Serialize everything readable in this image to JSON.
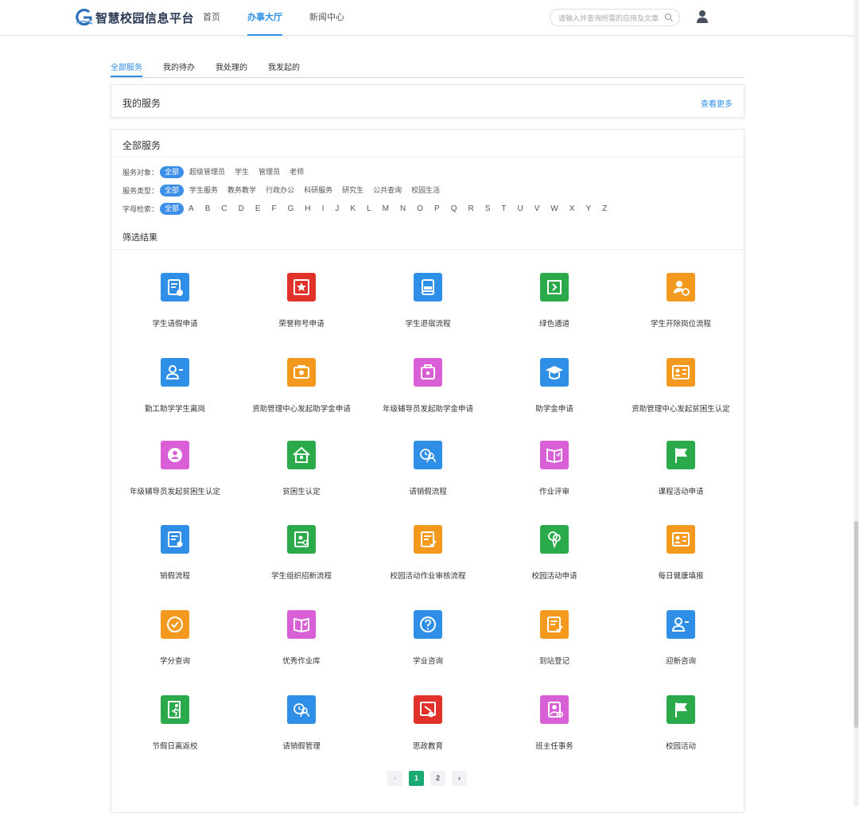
{
  "header": {
    "app_title": "智慧校园信息平台",
    "nav": [
      {
        "label": "首页",
        "active": false
      },
      {
        "label": "办事大厅",
        "active": true
      },
      {
        "label": "新闻中心",
        "active": false
      }
    ],
    "search_placeholder": "请输入并查询所需的应用及文章",
    "accent_color": "#2f8fe6"
  },
  "tabs": [
    {
      "label": "全部服务",
      "active": true
    },
    {
      "label": "我的待办",
      "active": false
    },
    {
      "label": "我处理的",
      "active": false
    },
    {
      "label": "我发起的",
      "active": false
    }
  ],
  "my_services": {
    "title": "我的服务",
    "more_label": "查看更多"
  },
  "all_services": {
    "title": "全部服务",
    "filters": {
      "target": {
        "label": "服务对象：",
        "options": [
          "全部",
          "超级管理员",
          "学生",
          "管理员",
          "老师"
        ],
        "selected": "全部"
      },
      "type": {
        "label": "服务类型：",
        "options": [
          "全部",
          "学生服务",
          "教务教学",
          "行政办公",
          "科研服务",
          "研究生",
          "公共查询",
          "校园生活"
        ],
        "selected": "全部"
      },
      "letter": {
        "label": "字母检索：",
        "options": [
          "全部",
          "A",
          "B",
          "C",
          "D",
          "E",
          "F",
          "G",
          "H",
          "I",
          "J",
          "K",
          "L",
          "M",
          "N",
          "O",
          "P",
          "Q",
          "R",
          "S",
          "T",
          "U",
          "V",
          "W",
          "X",
          "Y",
          "Z"
        ],
        "selected": "全部"
      }
    },
    "result_title": "筛选结果",
    "items": [
      {
        "label": "学生请假申请",
        "color": "#2f8fe6",
        "icon": "leave-form-icon"
      },
      {
        "label": "荣誉称号申请",
        "color": "#e0322b",
        "icon": "honor-icon"
      },
      {
        "label": "学生退宿流程",
        "color": "#2f8fe6",
        "icon": "bed-icon"
      },
      {
        "label": "绿色通道",
        "color": "#2aaa4a",
        "icon": "green-channel-icon"
      },
      {
        "label": "学生开除岗位流程",
        "color": "#f39a1e",
        "icon": "user-clock-icon"
      },
      {
        "label": "勤工助学学生离岗",
        "color": "#2f8fe6",
        "icon": "user-minus-icon"
      },
      {
        "label": "资助管理中心发起助学金申请",
        "color": "#f39a1e",
        "icon": "money-icon"
      },
      {
        "label": "年级辅导员发起助学金申请",
        "color": "#d95fd6",
        "icon": "bag-icon"
      },
      {
        "label": "助学金申请",
        "color": "#2f8fe6",
        "icon": "graduation-cap-icon"
      },
      {
        "label": "资助管理中心发起贫困生认定",
        "color": "#f39a1e",
        "icon": "id-card-icon"
      },
      {
        "label": "年级辅导员发起贫困生认定",
        "color": "#d95fd6",
        "icon": "person-circle-icon"
      },
      {
        "label": "贫困生认定",
        "color": "#2aaa4a",
        "icon": "home-icon"
      },
      {
        "label": "请销假流程",
        "color": "#2f8fe6",
        "icon": "clock-user-icon"
      },
      {
        "label": "作业评审",
        "color": "#d95fd6",
        "icon": "book-icon"
      },
      {
        "label": "课程活动申请",
        "color": "#2aaa4a",
        "icon": "flag-icon"
      },
      {
        "label": "销假流程",
        "color": "#2f8fe6",
        "icon": "form-clock-icon"
      },
      {
        "label": "学生组织招新流程",
        "color": "#2aaa4a",
        "icon": "recruit-icon"
      },
      {
        "label": "校园活动作业审核流程",
        "color": "#f39a1e",
        "icon": "edit-doc-icon"
      },
      {
        "label": "校园活动申请",
        "color": "#2aaa4a",
        "icon": "balloon-icon"
      },
      {
        "label": "每日健康填报",
        "color": "#f39a1e",
        "icon": "id-card-icon"
      },
      {
        "label": "学分查询",
        "color": "#f39a1e",
        "icon": "check-circle-icon"
      },
      {
        "label": "优秀作业库",
        "color": "#d95fd6",
        "icon": "book-icon"
      },
      {
        "label": "学业咨询",
        "color": "#2f8fe6",
        "icon": "question-icon"
      },
      {
        "label": "到站登记",
        "color": "#f39a1e",
        "icon": "edit-doc-icon"
      },
      {
        "label": "迎新咨询",
        "color": "#2f8fe6",
        "icon": "user-minus-icon"
      },
      {
        "label": "节假日离返校",
        "color": "#2aaa4a",
        "icon": "exit-icon"
      },
      {
        "label": "请销假管理",
        "color": "#2f8fe6",
        "icon": "clock-user-icon"
      },
      {
        "label": "思政教育",
        "color": "#e0322b",
        "icon": "education-icon"
      },
      {
        "label": "班主任事务",
        "color": "#d95fd6",
        "icon": "teacher-icon"
      },
      {
        "label": "校园活动",
        "color": "#2aaa4a",
        "icon": "flag-icon"
      }
    ]
  },
  "pagination": {
    "prev": "‹",
    "pages": [
      "1",
      "2"
    ],
    "current": "1",
    "next": "›",
    "current_color": "#1aaa72"
  }
}
